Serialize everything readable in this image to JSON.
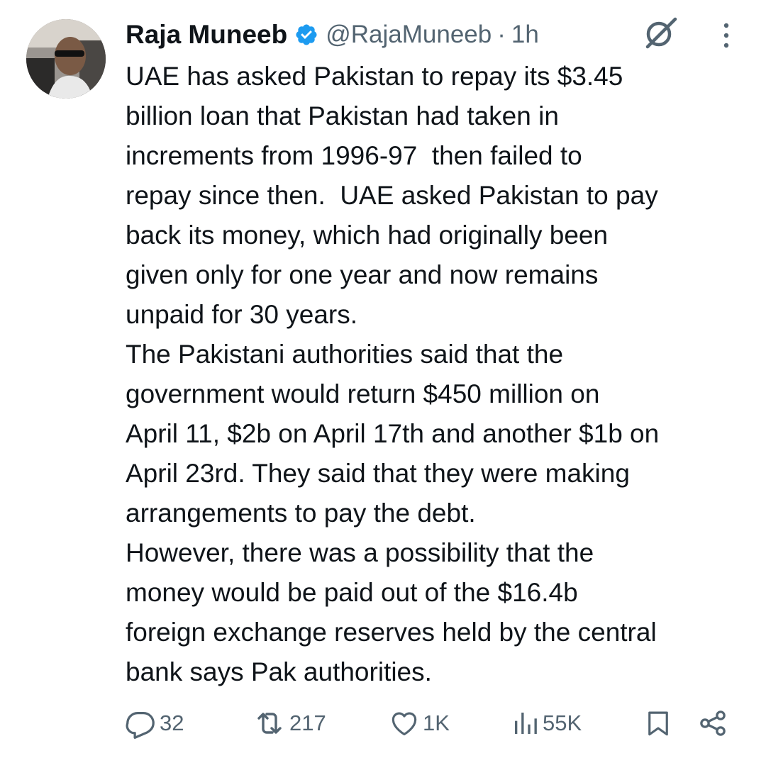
{
  "author": {
    "name": "Raja Muneeb",
    "handle": "@RajaMuneeb",
    "separator": "·",
    "time": "1h",
    "verified": true
  },
  "tweet": {
    "text": "UAE has asked Pakistan to repay its $3.45\nbillion loan that Pakistan had taken in\nincrements from 1996-97  then failed to\nrepay since then.  UAE asked Pakistan to pay\nback its money, which had originally been\ngiven only for one year and now remains\nunpaid for 30 years.\nThe Pakistani authorities said that the\ngovernment would return $450 million on\nApril 11, $2b on April 17th and another $1b on\nApril 23rd. They said that they were making\narrangements to pay the debt.\nHowever, there was a possibility that the\nmoney would be paid out of the $16.4b\nforeign exchange reserves held by the central\nbank says Pak authorities."
  },
  "actions": {
    "replies": "32",
    "reposts": "217",
    "likes": "1K",
    "views": "55K"
  },
  "icons": {
    "verified": "verified-badge-icon",
    "grok": "grok-icon",
    "more": "more-options-icon",
    "reply": "reply-icon",
    "repost": "repost-icon",
    "like": "heart-icon",
    "views": "views-icon",
    "bookmark": "bookmark-icon",
    "share": "share-icon"
  },
  "colors": {
    "text": "#0f1419",
    "secondary": "#536471",
    "verified": "#1d9bf0"
  }
}
